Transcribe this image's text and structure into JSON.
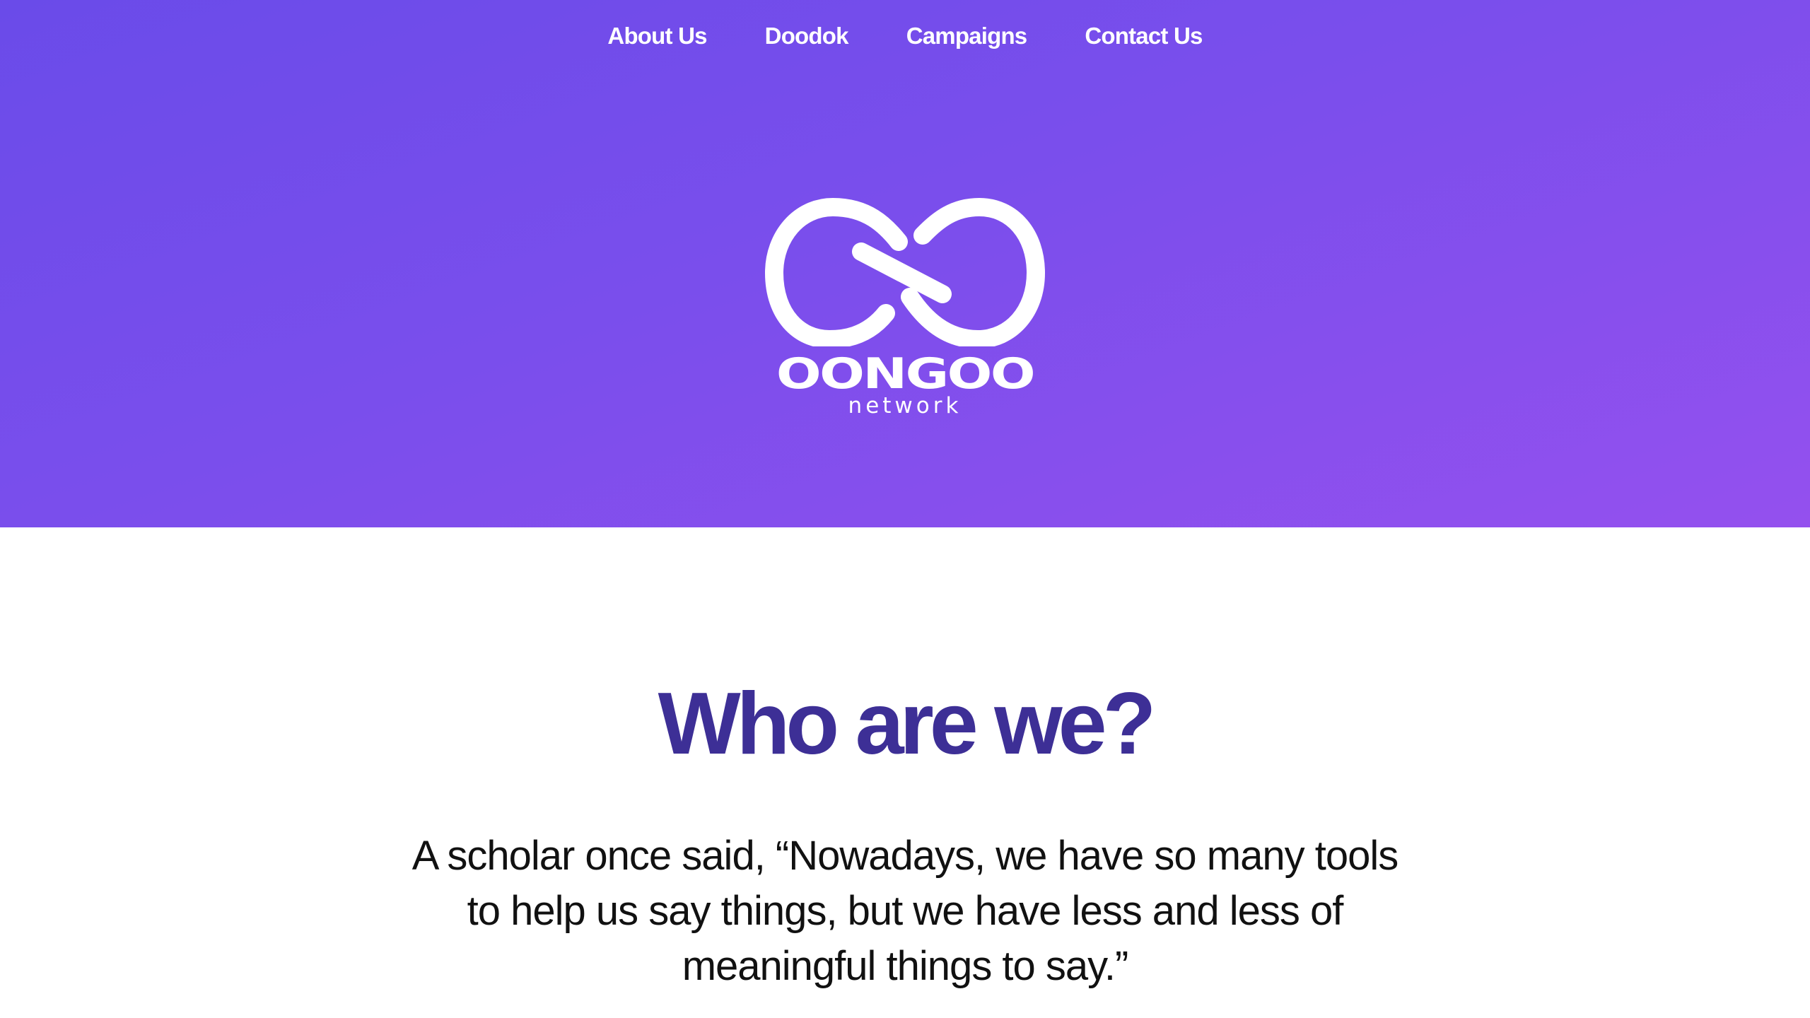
{
  "nav": {
    "items": [
      {
        "label": "About Us"
      },
      {
        "label": "Doodok"
      },
      {
        "label": "Campaigns"
      },
      {
        "label": "Contact Us"
      }
    ]
  },
  "hero": {
    "logo_icon": "infinity-loop-icon",
    "logo_wordmark": "OONGOO",
    "logo_subtitle": "network",
    "gradient_start": "#6a4be9",
    "gradient_end": "#9450ee"
  },
  "about": {
    "heading": "Who are we?",
    "quote": "A scholar once said, “Nowadays, we have so many tools to help us say things, but we have less and less of meaningful things to say.”",
    "heading_color": "#3d2f96"
  }
}
